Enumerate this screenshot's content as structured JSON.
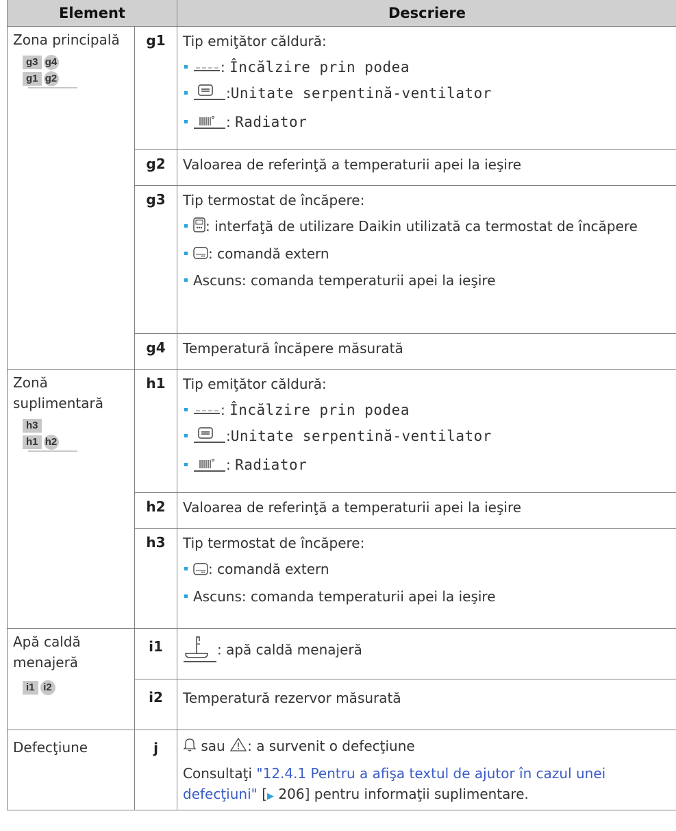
{
  "header": {
    "col_element": "Element",
    "col_description": "Descriere"
  },
  "zone_main": {
    "label": "Zona principală",
    "mini": [
      "g3",
      "g4",
      "g1",
      "g2"
    ],
    "g1": {
      "code": "g1",
      "title": "Tip emiţător căldură:",
      "items": [
        "Încălzire prin podea",
        "Unitate serpentină-ventilator",
        "Radiator"
      ]
    },
    "g2": {
      "code": "g2",
      "text": "Valoarea de referinţă a temperaturii apei la ieşire"
    },
    "g3": {
      "code": "g3",
      "title": "Tip termostat de încăpere:",
      "item1": "interfaţă de utilizare Daikin utilizată ca termostat de încăpere",
      "item2": "comandă extern",
      "item3": "Ascuns: comanda temperaturii apei la ieşire"
    },
    "g4": {
      "code": "g4",
      "text": "Temperatură încăpere măsurată"
    }
  },
  "zone_extra": {
    "label": "Zonă suplimentară",
    "mini": [
      "h3",
      "h1",
      "h2"
    ],
    "h1": {
      "code": "h1",
      "title": "Tip emiţător căldură:",
      "items": [
        "Încălzire prin podea",
        "Unitate serpentină-ventilator",
        "Radiator"
      ]
    },
    "h2": {
      "code": "h2",
      "text": "Valoarea de referinţă a temperaturii apei la ieşire"
    },
    "h3": {
      "code": "h3",
      "title": "Tip termostat de încăpere:",
      "item1": "comandă extern",
      "item2": "Ascuns: comanda temperaturii apei la ieşire"
    }
  },
  "dhw": {
    "label": "Apă caldă menajeră",
    "mini": [
      "i1",
      "i2"
    ],
    "i1": {
      "code": "i1",
      "text": "apă caldă menajeră"
    },
    "i2": {
      "code": "i2",
      "text": "Temperatură rezervor măsurată"
    }
  },
  "fault": {
    "label": "Defecţiune",
    "j": {
      "code": "j",
      "or_word": "sau",
      "text": "a survenit o defecţiune",
      "see_prefix": "Consultaţi ",
      "link": "\"12.4.1 Pentru a afişa textul de ajutor în cazul unei defecţiuni\"",
      "page_ref": "206",
      "see_suffix": "pentru informaţii suplimentare."
    }
  },
  "icons": {
    "bullet_color": "#29a3dc",
    "link_color": "#3a5cc7",
    "header_bg": "#d0d0d0"
  }
}
